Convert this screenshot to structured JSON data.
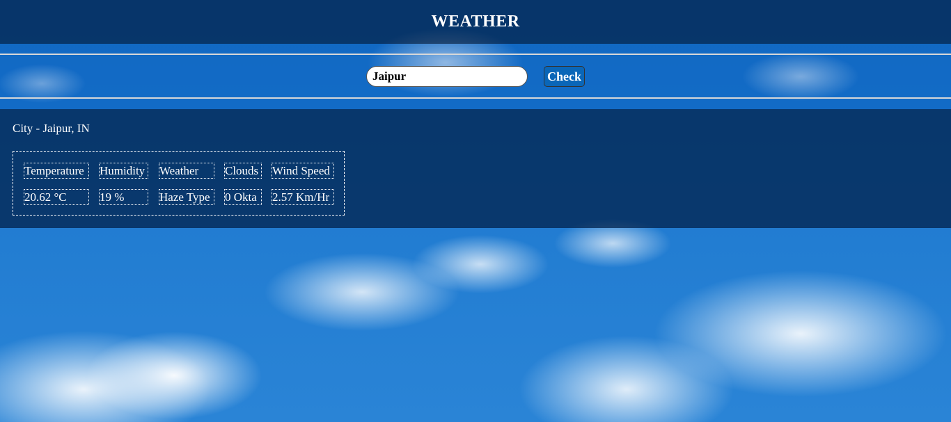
{
  "header": {
    "title": "WEATHER"
  },
  "search": {
    "value": "Jaipur",
    "button_label": "Check"
  },
  "result": {
    "city_line": "City - Jaipur, IN",
    "headers": [
      "Temperature",
      "Humidity",
      "Weather",
      "Clouds",
      "Wind Speed"
    ],
    "values": [
      "20.62 °C",
      "19 %",
      "Haze Type",
      "0 Okta",
      "2.57 Km/Hr"
    ]
  },
  "colors": {
    "header_bg": "#001e46",
    "button_bg": "#0a66b8",
    "text": "#ffffff"
  }
}
